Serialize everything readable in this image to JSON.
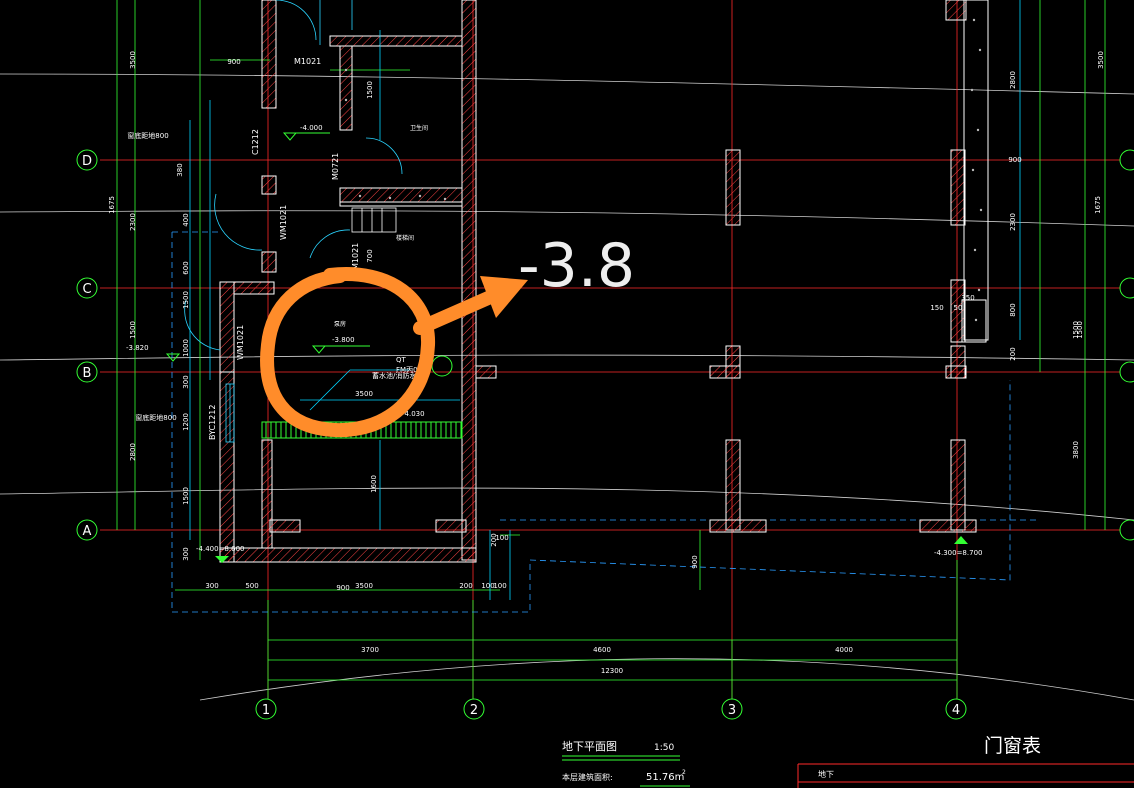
{
  "drawing": {
    "grid_bubbles_rows": [
      "D",
      "C",
      "B",
      "A"
    ],
    "grid_bubbles_cols": [
      "1",
      "2",
      "3",
      "4"
    ],
    "dims_bottom": [
      "3700",
      "4600",
      "4000",
      "12300"
    ],
    "dims_bottom_detail": [
      "300",
      "500",
      "900",
      "3500",
      "200",
      "100"
    ],
    "dims_left": [
      "3500",
      "1675",
      "2300",
      "1500",
      "2800",
      "380",
      "400",
      "600",
      "1000",
      "1500",
      "300",
      "1200",
      "1500",
      "300",
      "200",
      "300"
    ],
    "dims_right": [
      "3500",
      "2800",
      "900",
      "2300",
      "800",
      "1500",
      "3800",
      "1675",
      "200"
    ],
    "dims_top": [
      "900"
    ],
    "door_labels": [
      "M1021",
      "M0721",
      "M1021",
      "C1212",
      "WM1021",
      "WM1021",
      "BYC1212",
      "FM丙0721",
      "QT"
    ],
    "level_labels": [
      "-4.000",
      "-3.800",
      "-3.820",
      "-4.400=8.600",
      "-4.300=8.700",
      "-4.030"
    ],
    "room_labels": [
      "卫生间",
      "蓄水池/消防水泵",
      "楼梯间",
      "泵房"
    ],
    "window_note": "窗底距地800",
    "window_note2": "窗底距地800",
    "misc_dims": [
      "150",
      "50",
      "350",
      "100",
      "3500",
      "1600",
      "1500",
      "100",
      "900",
      "200",
      "700",
      "1500"
    ],
    "title_block": {
      "plan_title": "地下平面图",
      "scale": "1:50",
      "area_label": "本层建筑面积:",
      "area_value": "51.76m",
      "area_sup": "2",
      "door_window_table": "门窗表",
      "table_row_1": "地下"
    },
    "colors": {
      "background": "#000000",
      "grid_axis": "#ff2a2a",
      "dimension": "#33ff33",
      "wall": "#ffffff",
      "hatch": "#ff5555",
      "leader": "#00e5ff",
      "annotation": "#ff8c2a",
      "contour": "#ffffff"
    }
  },
  "annotation": {
    "value_text": "-3.8",
    "shape": "circle-with-arrow"
  }
}
